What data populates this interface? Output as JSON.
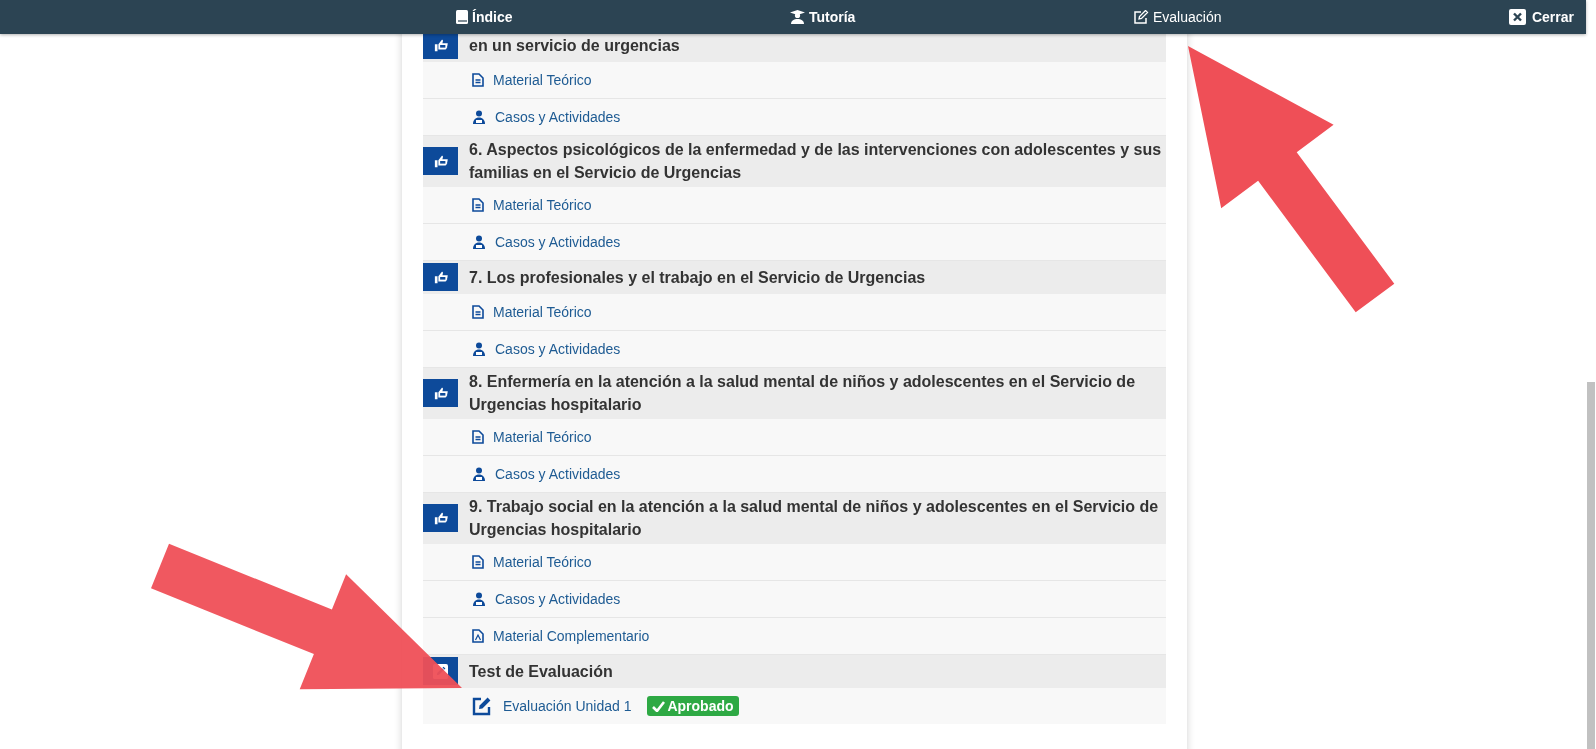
{
  "top_bar": {
    "tabs": [
      {
        "label": "Índice",
        "kind": "book"
      },
      {
        "label": "Tutoría",
        "kind": "tutor"
      },
      {
        "label": "Evaluación",
        "kind": "edit"
      }
    ],
    "close": "Cerrar"
  },
  "units": [
    {
      "title": "en un servicio de urgencias",
      "kind": "unit",
      "items": [
        {
          "label": "Material Teórico",
          "kind": "doc"
        },
        {
          "label": "Casos y Actividades",
          "kind": "cases"
        }
      ]
    },
    {
      "title": "6. Aspectos psicológicos de la enfermedad y de las intervenciones con adolescentes y sus familias en el Servicio de Urgencias",
      "kind": "unit",
      "items": [
        {
          "label": "Material Teórico",
          "kind": "doc"
        },
        {
          "label": "Casos y Actividades",
          "kind": "cases"
        }
      ]
    },
    {
      "title": "7. Los profesionales y el trabajo en el Servicio de Urgencias",
      "kind": "unit",
      "items": [
        {
          "label": "Material Teórico",
          "kind": "doc"
        },
        {
          "label": "Casos y Actividades",
          "kind": "cases"
        }
      ]
    },
    {
      "title": "8. Enfermería en la atención a la salud mental de niños y adolescentes en el Servicio de Urgencias hospitalario",
      "kind": "unit",
      "items": [
        {
          "label": "Material Teórico",
          "kind": "doc"
        },
        {
          "label": "Casos y Actividades",
          "kind": "cases"
        }
      ]
    },
    {
      "title": "9. Trabajo social en la atención a la salud mental de niños y adolescentes en el Servicio de Urgencias hospitalario",
      "kind": "unit",
      "items": [
        {
          "label": "Material Teórico",
          "kind": "doc"
        },
        {
          "label": "Casos y Actividades",
          "kind": "cases"
        },
        {
          "label": "Material Complementario",
          "kind": "pdf"
        }
      ]
    },
    {
      "title": "Test de Evaluación",
      "kind": "test",
      "items": [
        {
          "label": "Evaluación Unidad 1",
          "kind": "eval",
          "status": "Aprobado"
        }
      ]
    }
  ]
}
